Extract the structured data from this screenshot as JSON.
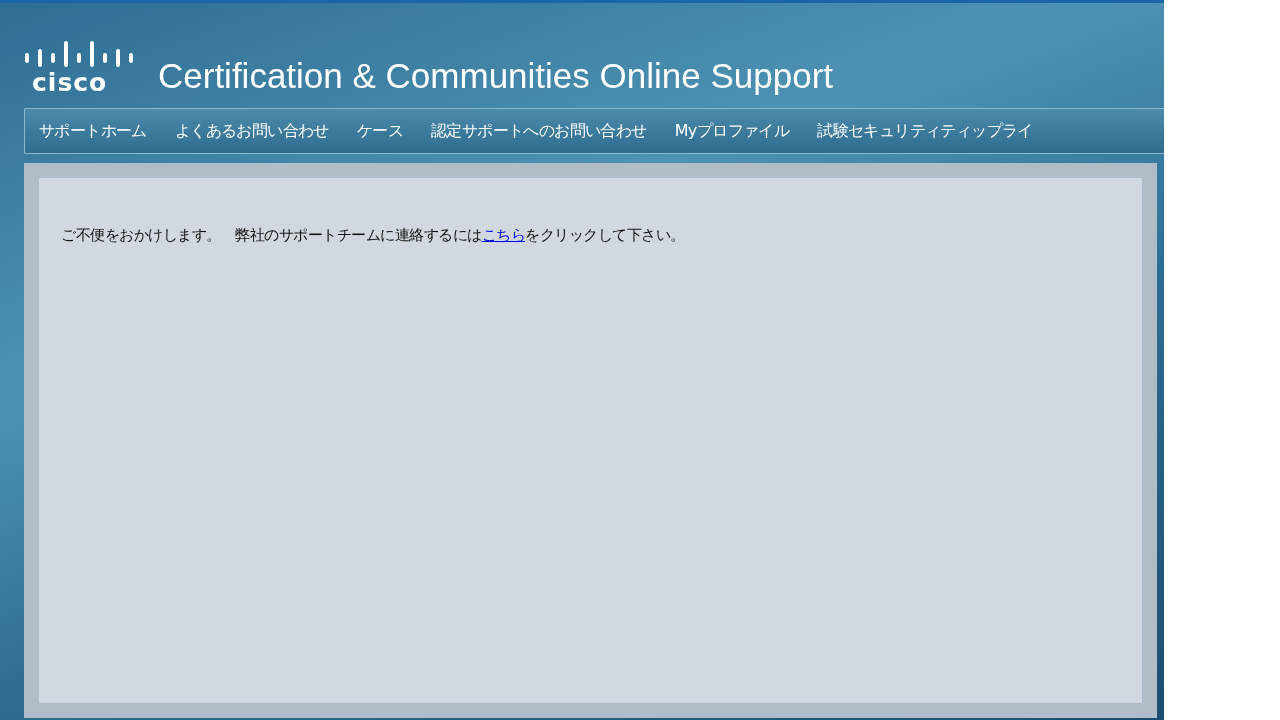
{
  "header": {
    "logo_text": "cisco",
    "title": "Certification & Communities Online Support"
  },
  "nav": {
    "items": [
      {
        "label": "サポートホーム"
      },
      {
        "label": "よくあるお問い合わせ"
      },
      {
        "label": "ケース"
      },
      {
        "label": "認定サポートへのお問い合わせ"
      },
      {
        "label": "Myプロファイル"
      },
      {
        "label": "試験セキュリティティップライ"
      }
    ]
  },
  "message": {
    "before": "ご不便をおかけします。　弊社のサポートチームに連絡するには",
    "link": "こちら",
    "after": "をクリックして下さい。"
  }
}
